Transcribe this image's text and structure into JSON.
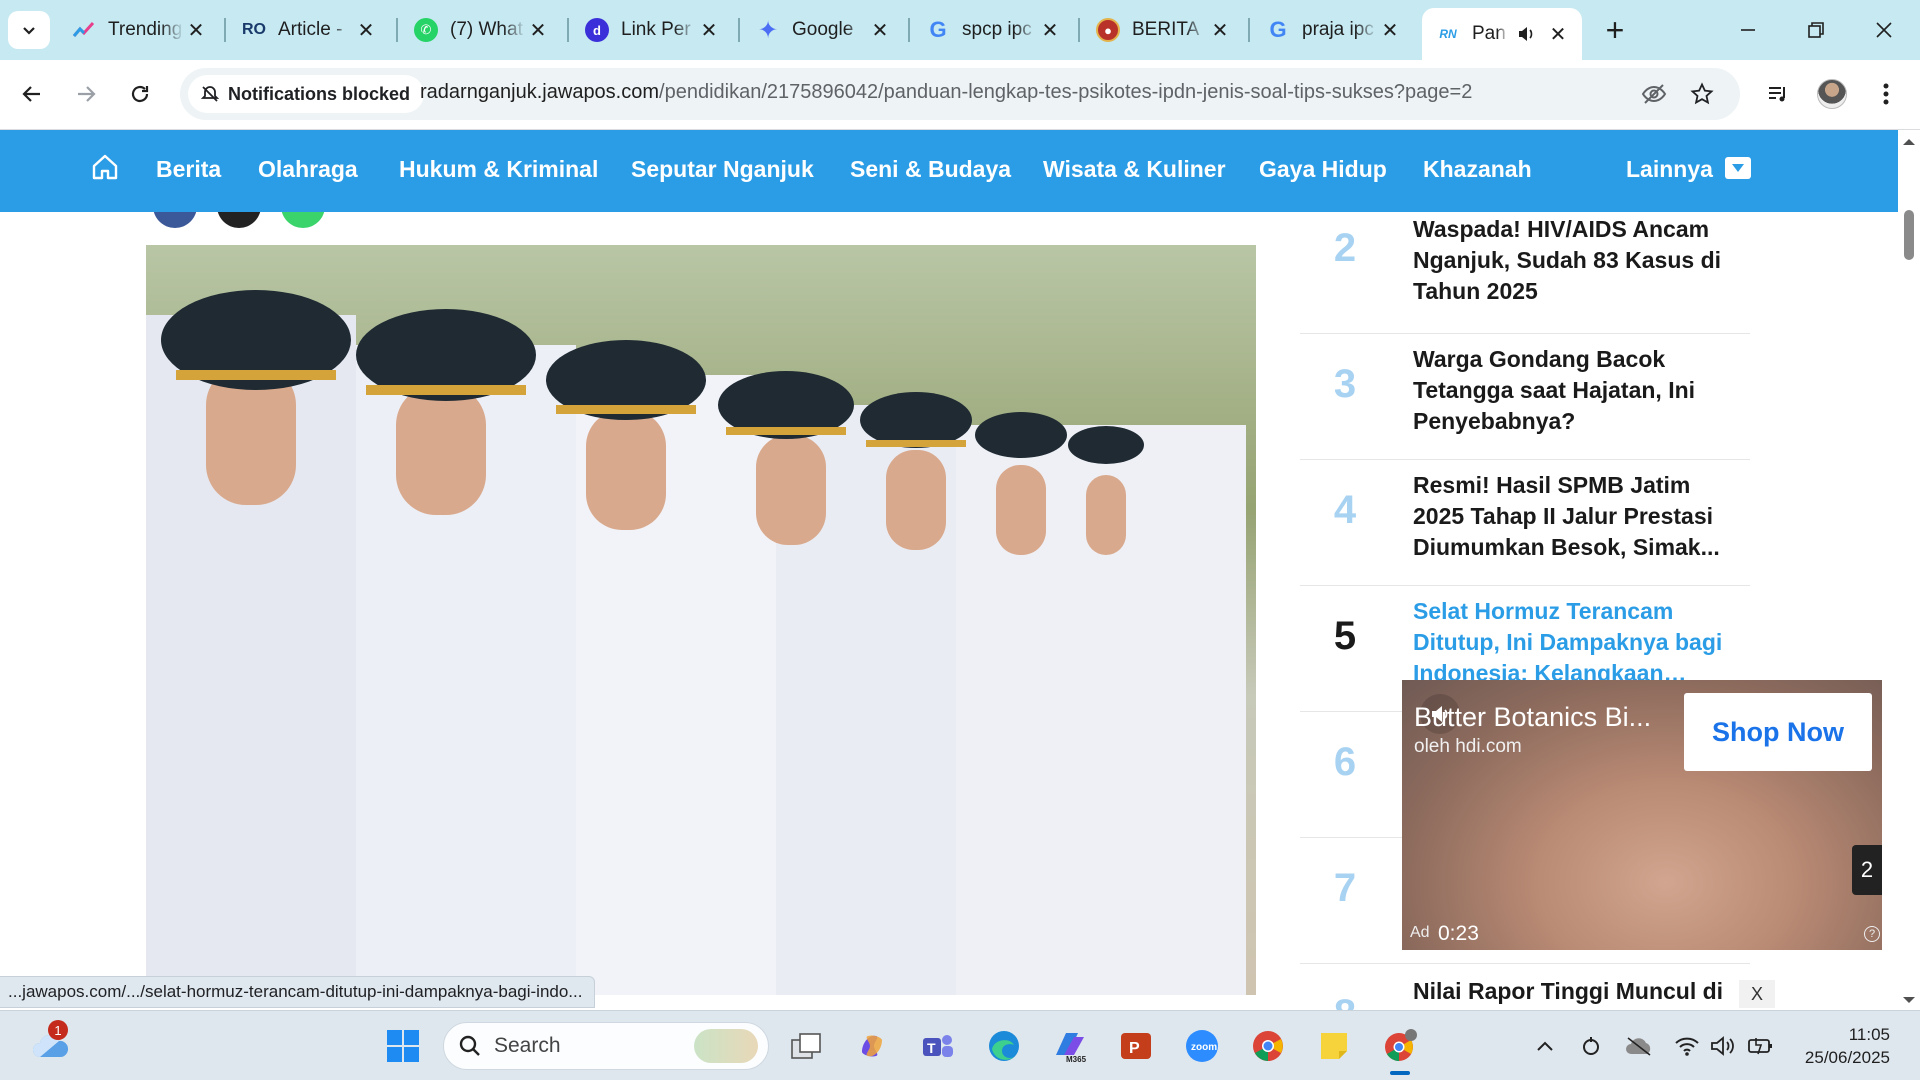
{
  "tabs": [
    {
      "title": "Trending",
      "favicon": "trending-icon",
      "color": "#e83e8c"
    },
    {
      "title": "Article -",
      "favicon": "ro-logo-icon",
      "color": "#1a3a6b"
    },
    {
      "title": "(7) What",
      "favicon": "whatsapp-icon",
      "color": "#25d366"
    },
    {
      "title": "Link Per",
      "favicon": "link-d-icon",
      "color": "#3a2fd9"
    },
    {
      "title": "Google",
      "favicon": "gemini-icon",
      "color": "#4c6ef5"
    },
    {
      "title": "spcp ipc",
      "favicon": "google-icon",
      "color": "#4285f4"
    },
    {
      "title": "BERITA",
      "favicon": "garuda-icon",
      "color": "#b8322a"
    },
    {
      "title": "praja ipc",
      "favicon": "google-icon",
      "color": "#4285f4"
    },
    {
      "title": "Pan",
      "favicon": "jawapos-icon",
      "color": "#2b9de6"
    }
  ],
  "omnibox": {
    "notification_chip": "Notifications blocked",
    "url_domain": "radarnganjuk.jawapos.com",
    "url_path": "/pendidikan/2175896042/panduan-lengkap-tes-psikotes-ipdn-jenis-soal-tips-sukses?page=2"
  },
  "nav": {
    "items": [
      "Berita",
      "Olahraga",
      "Hukum & Kriminal",
      "Seputar Nganjuk",
      "Seni & Budaya",
      "Wisata & Kuliner",
      "Gaya Hidup",
      "Khazanah"
    ],
    "more": "Lainnya"
  },
  "popular": [
    {
      "num": "2",
      "title": "Waspada! HIV/AIDS Ancam Nganjuk, Sudah 83 Kasus di Tahun 2025"
    },
    {
      "num": "3",
      "title": "Warga Gondang Bacok Tetangga saat Hajatan, Ini Penyebabnya?"
    },
    {
      "num": "4",
      "title": "Resmi! Hasil SPMB Jatim 2025 Tahap II Jalur Prestasi Diumumkan Besok, Simak..."
    },
    {
      "num": "5",
      "title": "Selat Hormuz Terancam Ditutup, Ini Dampaknya bagi Indonesia: Kelangkaan BBM..."
    },
    {
      "num": "6",
      "title": ""
    },
    {
      "num": "7",
      "title": ""
    },
    {
      "num": "8",
      "title": "Nilai Rapor Tinggi Muncul di"
    }
  ],
  "ad": {
    "headline": "Butter Botanics Bi...",
    "by": "oleh hdi.com",
    "cta": "Shop Now",
    "count": "2",
    "label": "Ad",
    "time": "0:23",
    "close": "X"
  },
  "status_url": "...jawapos.com/.../selat-hormuz-terancam-ditutup-ini-dampaknya-bagi-indo...",
  "taskbar": {
    "weather_badge": "1",
    "search_placeholder": "Search",
    "time": "11:05",
    "date": "25/06/2025"
  },
  "colors": {
    "tabstrip": "#c6e9f2",
    "site_nav": "#2b9de6",
    "popular_num": "#a8d2f2",
    "active_link": "#2b9de6"
  }
}
